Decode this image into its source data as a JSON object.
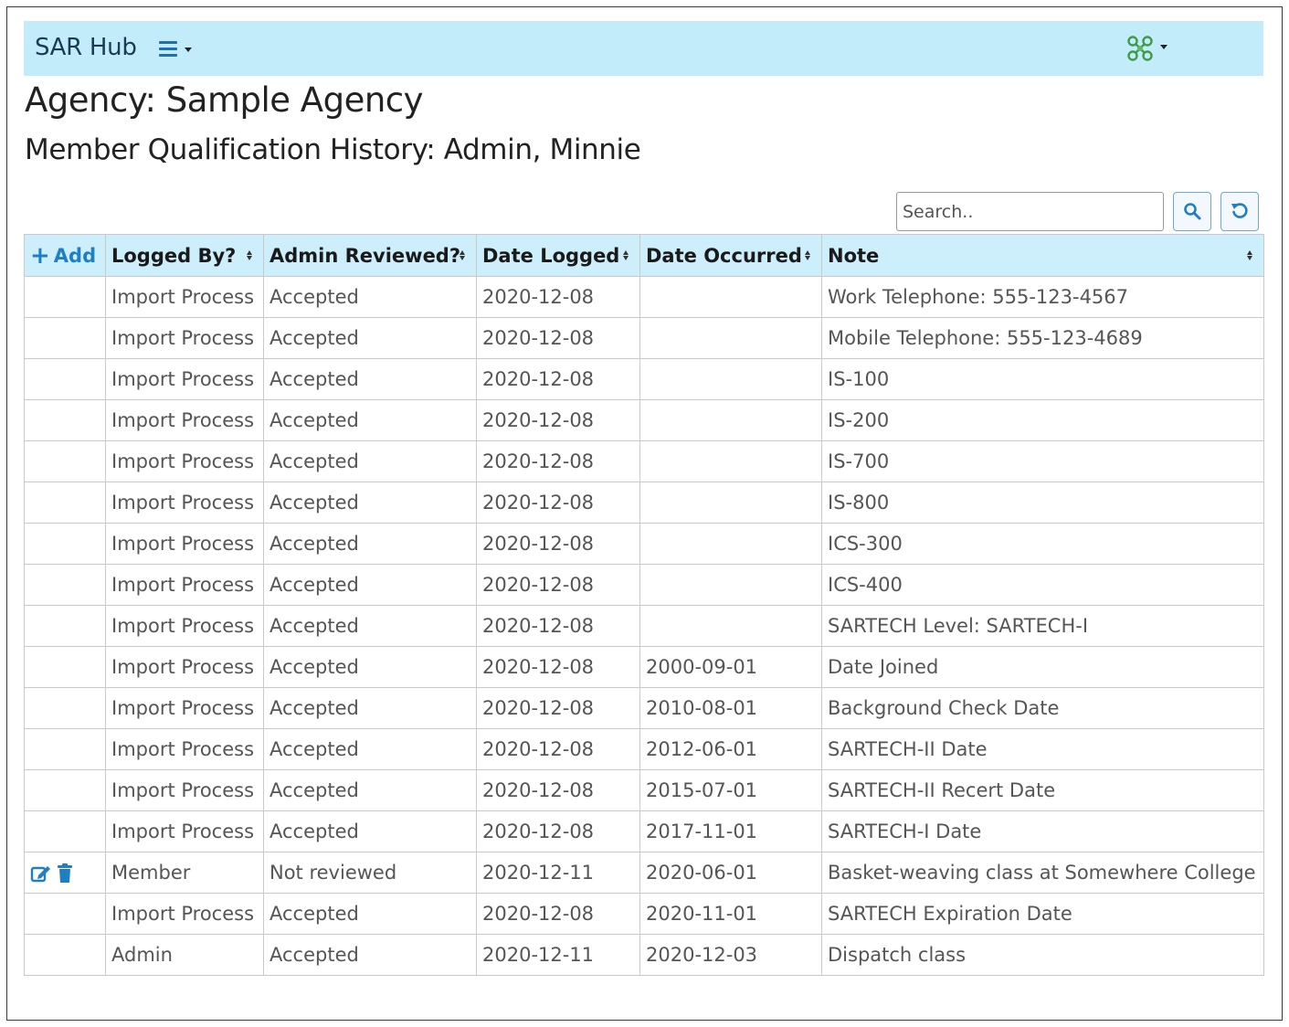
{
  "nav": {
    "brand": "SAR Hub",
    "menu_icon": "hamburger-menu-icon",
    "logo_icon": "agency-logo-icon"
  },
  "page": {
    "agency_title": "Agency: Sample Agency",
    "history_title": "Member Qualification History: Admin, Minnie"
  },
  "search": {
    "placeholder": "Search..",
    "value": "",
    "search_icon": "search-icon",
    "reset_icon": "reset-icon"
  },
  "table": {
    "add_label": "Add",
    "columns": [
      "Logged By?",
      "Admin Reviewed?",
      "Date Logged",
      "Date Occurred",
      "Note"
    ],
    "rows": [
      {
        "logged_by": "Import Process",
        "reviewed": "Accepted",
        "date_logged": "2020-12-08",
        "date_occurred": "",
        "note": "Work Telephone: 555-123-4567",
        "editable": false
      },
      {
        "logged_by": "Import Process",
        "reviewed": "Accepted",
        "date_logged": "2020-12-08",
        "date_occurred": "",
        "note": "Mobile Telephone: 555-123-4689",
        "editable": false
      },
      {
        "logged_by": "Import Process",
        "reviewed": "Accepted",
        "date_logged": "2020-12-08",
        "date_occurred": "",
        "note": "IS-100",
        "editable": false
      },
      {
        "logged_by": "Import Process",
        "reviewed": "Accepted",
        "date_logged": "2020-12-08",
        "date_occurred": "",
        "note": "IS-200",
        "editable": false
      },
      {
        "logged_by": "Import Process",
        "reviewed": "Accepted",
        "date_logged": "2020-12-08",
        "date_occurred": "",
        "note": "IS-700",
        "editable": false
      },
      {
        "logged_by": "Import Process",
        "reviewed": "Accepted",
        "date_logged": "2020-12-08",
        "date_occurred": "",
        "note": "IS-800",
        "editable": false
      },
      {
        "logged_by": "Import Process",
        "reviewed": "Accepted",
        "date_logged": "2020-12-08",
        "date_occurred": "",
        "note": "ICS-300",
        "editable": false
      },
      {
        "logged_by": "Import Process",
        "reviewed": "Accepted",
        "date_logged": "2020-12-08",
        "date_occurred": "",
        "note": "ICS-400",
        "editable": false
      },
      {
        "logged_by": "Import Process",
        "reviewed": "Accepted",
        "date_logged": "2020-12-08",
        "date_occurred": "",
        "note": "SARTECH Level: SARTECH-I",
        "editable": false
      },
      {
        "logged_by": "Import Process",
        "reviewed": "Accepted",
        "date_logged": "2020-12-08",
        "date_occurred": "2000-09-01",
        "note": "Date Joined",
        "editable": false
      },
      {
        "logged_by": "Import Process",
        "reviewed": "Accepted",
        "date_logged": "2020-12-08",
        "date_occurred": "2010-08-01",
        "note": "Background Check Date",
        "editable": false
      },
      {
        "logged_by": "Import Process",
        "reviewed": "Accepted",
        "date_logged": "2020-12-08",
        "date_occurred": "2012-06-01",
        "note": "SARTECH-II Date",
        "editable": false
      },
      {
        "logged_by": "Import Process",
        "reviewed": "Accepted",
        "date_logged": "2020-12-08",
        "date_occurred": "2015-07-01",
        "note": "SARTECH-II Recert Date",
        "editable": false
      },
      {
        "logged_by": "Import Process",
        "reviewed": "Accepted",
        "date_logged": "2020-12-08",
        "date_occurred": "2017-11-01",
        "note": "SARTECH-I Date",
        "editable": false
      },
      {
        "logged_by": "Member",
        "reviewed": "Not reviewed",
        "date_logged": "2020-12-11",
        "date_occurred": "2020-06-01",
        "note": "Basket-weaving class at Somewhere College",
        "editable": true
      },
      {
        "logged_by": "Import Process",
        "reviewed": "Accepted",
        "date_logged": "2020-12-08",
        "date_occurred": "2020-11-01",
        "note": "SARTECH Expiration Date",
        "editable": false
      },
      {
        "logged_by": "Admin",
        "reviewed": "Accepted",
        "date_logged": "2020-12-11",
        "date_occurred": "2020-12-03",
        "note": "Dispatch class",
        "editable": false
      }
    ]
  },
  "colors": {
    "navbar_bg": "#c3ecfb",
    "header_bg": "#cdeefb",
    "accent_blue": "#1f7fc4",
    "logo_green": "#3f9a4a"
  }
}
